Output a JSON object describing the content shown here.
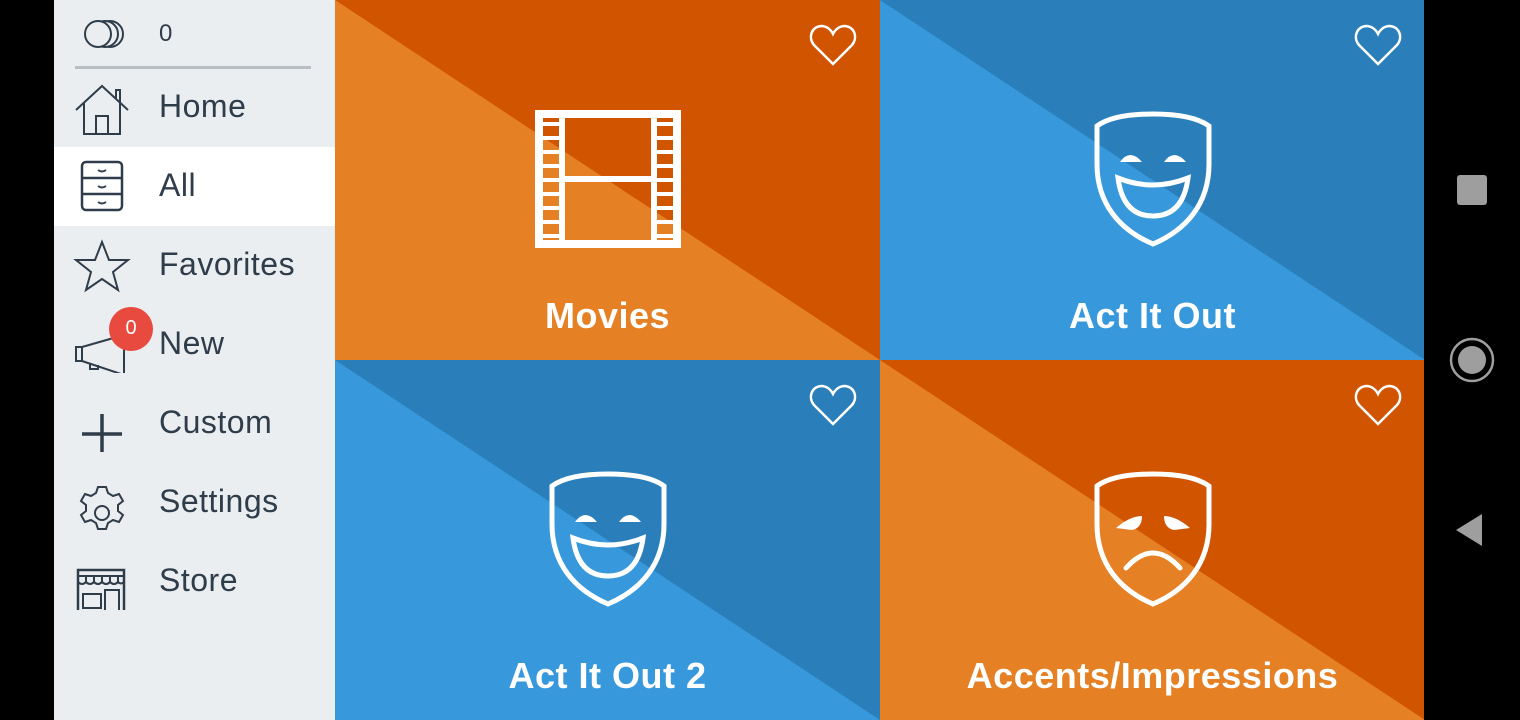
{
  "sidebar": {
    "coins": {
      "icon": "coins-icon",
      "value": "0"
    },
    "items": [
      {
        "label": "Home",
        "icon": "home-icon",
        "active": false
      },
      {
        "label": "All",
        "icon": "drawer-cabinet-icon",
        "active": true
      },
      {
        "label": "Favorites",
        "icon": "star-icon",
        "active": false
      },
      {
        "label": "New",
        "icon": "megaphone-icon",
        "active": false,
        "badge": "0"
      },
      {
        "label": "Custom",
        "icon": "plus-icon",
        "active": false
      },
      {
        "label": "Settings",
        "icon": "gear-icon",
        "active": false
      },
      {
        "label": "Store",
        "icon": "storefront-icon",
        "active": false
      }
    ]
  },
  "tiles": [
    {
      "title": "Movies",
      "icon": "film-strip-icon",
      "theme": "orange",
      "favorited": false
    },
    {
      "title": "Act It Out",
      "icon": "comedy-mask-icon",
      "theme": "blue",
      "favorited": false
    },
    {
      "title": "Act It Out 2",
      "icon": "comedy-mask-icon",
      "theme": "blue",
      "favorited": false
    },
    {
      "title": "Accents/Impressions",
      "icon": "tragedy-mask-icon",
      "theme": "orange",
      "favorited": false
    }
  ],
  "colors": {
    "orange_light": "#e58024",
    "orange_dark": "#d15400",
    "blue_light": "#3799db",
    "blue_dark": "#2a7fba",
    "sidebar_bg": "#ebeef0",
    "sidebar_text": "#2f3c4a",
    "badge": "#e84a3f"
  },
  "system_nav": {
    "recents": "recents-square-icon",
    "home": "home-circle-icon",
    "back": "back-triangle-icon"
  }
}
